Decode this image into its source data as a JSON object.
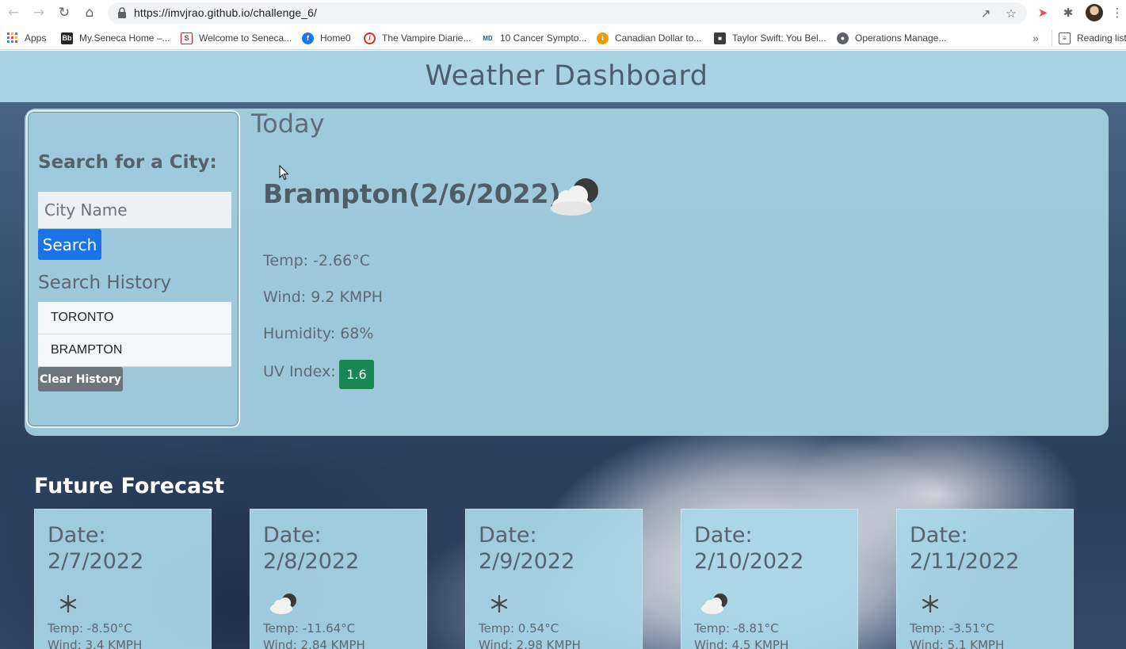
{
  "browser": {
    "url": "https://imvjrao.github.io/challenge_6/",
    "bookmarks": [
      {
        "label": "Apps",
        "icon": "apps-grid-icon",
        "color": "#4285f4"
      },
      {
        "label": "My.Seneca Home –...",
        "icon": "blackboard-icon",
        "color": "#262626"
      },
      {
        "label": "Welcome to Seneca...",
        "icon": "seneca-library-icon",
        "color": "#c1272d"
      },
      {
        "label": "Home0",
        "icon": "facebook-icon",
        "color": "#1877f2"
      },
      {
        "label": "The Vampire Diarie...",
        "icon": "vampire-diaries-icon",
        "color": "#d93025"
      },
      {
        "label": "10 Cancer Sympto...",
        "icon": "webmd-icon",
        "color": "#2b5c8a"
      },
      {
        "label": "Canadian Dollar to...",
        "icon": "info-orange-icon",
        "color": "#f29900"
      },
      {
        "label": "Taylor Swift: You Bel...",
        "icon": "imdb-clapper-icon",
        "color": "#3c3c3c"
      },
      {
        "label": "Operations Manage...",
        "icon": "globe-icon",
        "color": "#5f6368"
      }
    ],
    "reading_list": "Reading list"
  },
  "header": {
    "title": "Weather Dashboard"
  },
  "search": {
    "heading": "Search for a City:",
    "placeholder": "City Name",
    "button": "Search",
    "history_heading": "Search History",
    "history": [
      "TORONTO",
      "BRAMPTON"
    ],
    "clear_button": "Clear History"
  },
  "today": {
    "label": "Today",
    "city_date": "Brampton(2/6/2022)",
    "icon": "cloud-night-icon",
    "temp": "Temp: -2.66°C",
    "wind": "Wind: 9.2 KMPH",
    "humidity": "Humidity: 68%",
    "uv_label": "UV Index:",
    "uv_value": "1.6",
    "uv_color": "#198754"
  },
  "forecast": {
    "heading": "Future Forecast",
    "days": [
      {
        "date": "Date: 2/7/2022",
        "icon": "snowflake-icon",
        "temp": "Temp: -8.50°C",
        "wind": "Wind: 3.4 KMPH"
      },
      {
        "date": "Date: 2/8/2022",
        "icon": "cloud-night-icon",
        "temp": "Temp: -11.64°C",
        "wind": "Wind: 2.84 KMPH"
      },
      {
        "date": "Date: 2/9/2022",
        "icon": "snowflake-icon",
        "temp": "Temp: 0.54°C",
        "wind": "Wind: 2.98 KMPH"
      },
      {
        "date": "Date: 2/10/2022",
        "icon": "cloud-night-icon",
        "temp": "Temp: -8.81°C",
        "wind": "Wind: 4.5 KMPH"
      },
      {
        "date": "Date: 2/11/2022",
        "icon": "snowflake-icon",
        "temp": "Temp: -3.51°C",
        "wind": "Wind: 5.1 KMPH"
      }
    ]
  }
}
